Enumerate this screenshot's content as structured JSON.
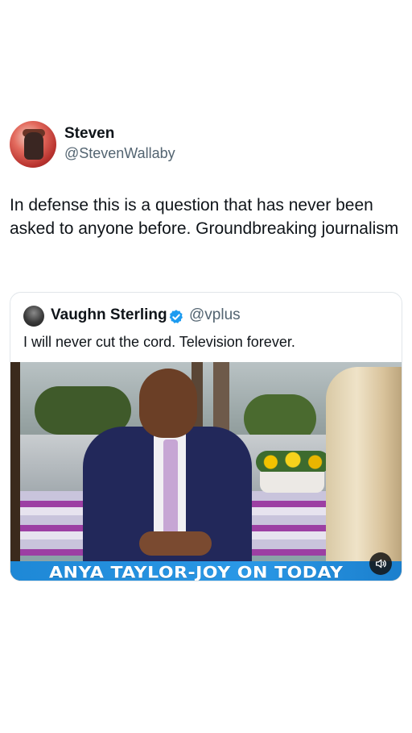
{
  "post": {
    "author_name": "Steven",
    "author_handle": "@StevenWallaby",
    "text": "In defense this is a question that has never been asked to anyone before. Groundbreaking journalism"
  },
  "quoted": {
    "author_name": "Vaughn Sterling",
    "verified": true,
    "author_handle": "@vplus",
    "text": "I will never cut the cord. Television forever.",
    "video_banner": "ANYA TAYLOR-JOY ON TODAY",
    "sound_icon": "speaker-icon"
  },
  "colors": {
    "text_primary": "#0f1419",
    "text_secondary": "#536471",
    "verified_blue": "#1d9bf0",
    "banner_blue": "#2a98e6"
  }
}
